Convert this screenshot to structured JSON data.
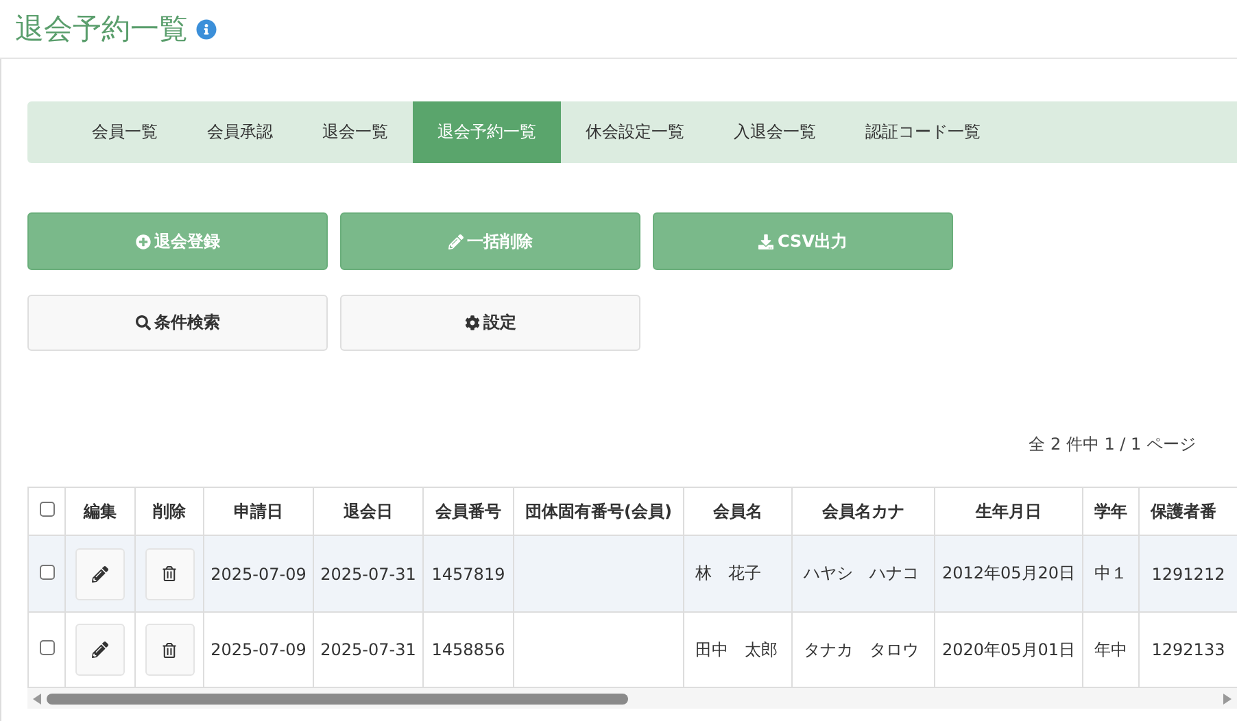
{
  "page_title": "退会予約一覧",
  "tabs": [
    {
      "label": "会員一覧",
      "selected": false
    },
    {
      "label": "会員承認",
      "selected": false
    },
    {
      "label": "退会一覧",
      "selected": false
    },
    {
      "label": "退会予約一覧",
      "selected": true
    },
    {
      "label": "休会設定一覧",
      "selected": false
    },
    {
      "label": "入退会一覧",
      "selected": false
    },
    {
      "label": "認証コード一覧",
      "selected": false
    }
  ],
  "action_rows": [
    [
      {
        "label": "退会登録",
        "kind": "primary"
      },
      {
        "label": "一括削除",
        "kind": "primary"
      },
      {
        "label": "CSV出力",
        "kind": "primary"
      }
    ],
    [
      {
        "label": "条件検索",
        "kind": "default"
      },
      {
        "label": "設定",
        "kind": "default"
      }
    ]
  ],
  "pagination": "全 2 件中 1 / 1 ページ",
  "table": {
    "select_all_checked": false,
    "columns": [
      "",
      "編集",
      "削除",
      "申請日",
      "退会日",
      "会員番号",
      "団体固有番号(会員)",
      "会員名",
      "会員名カナ",
      "生年月日",
      "学年",
      "保護者番"
    ],
    "rows": [
      {
        "checked": false,
        "highlighted": true,
        "cells": [
          "",
          "",
          "",
          "2025-07-09",
          "2025-07-31",
          "1457819",
          "",
          "林　花子",
          "ハヤシ　ハナコ",
          "2012年05月20日",
          "中１",
          "1291212"
        ]
      },
      {
        "checked": false,
        "highlighted": false,
        "cells": [
          "",
          "",
          "",
          "2025-07-09",
          "2025-07-31",
          "1458856",
          "",
          "田中　太郎",
          "タナカ　タロウ",
          "2020年05月01日",
          "年中",
          "1292133"
        ]
      }
    ]
  }
}
